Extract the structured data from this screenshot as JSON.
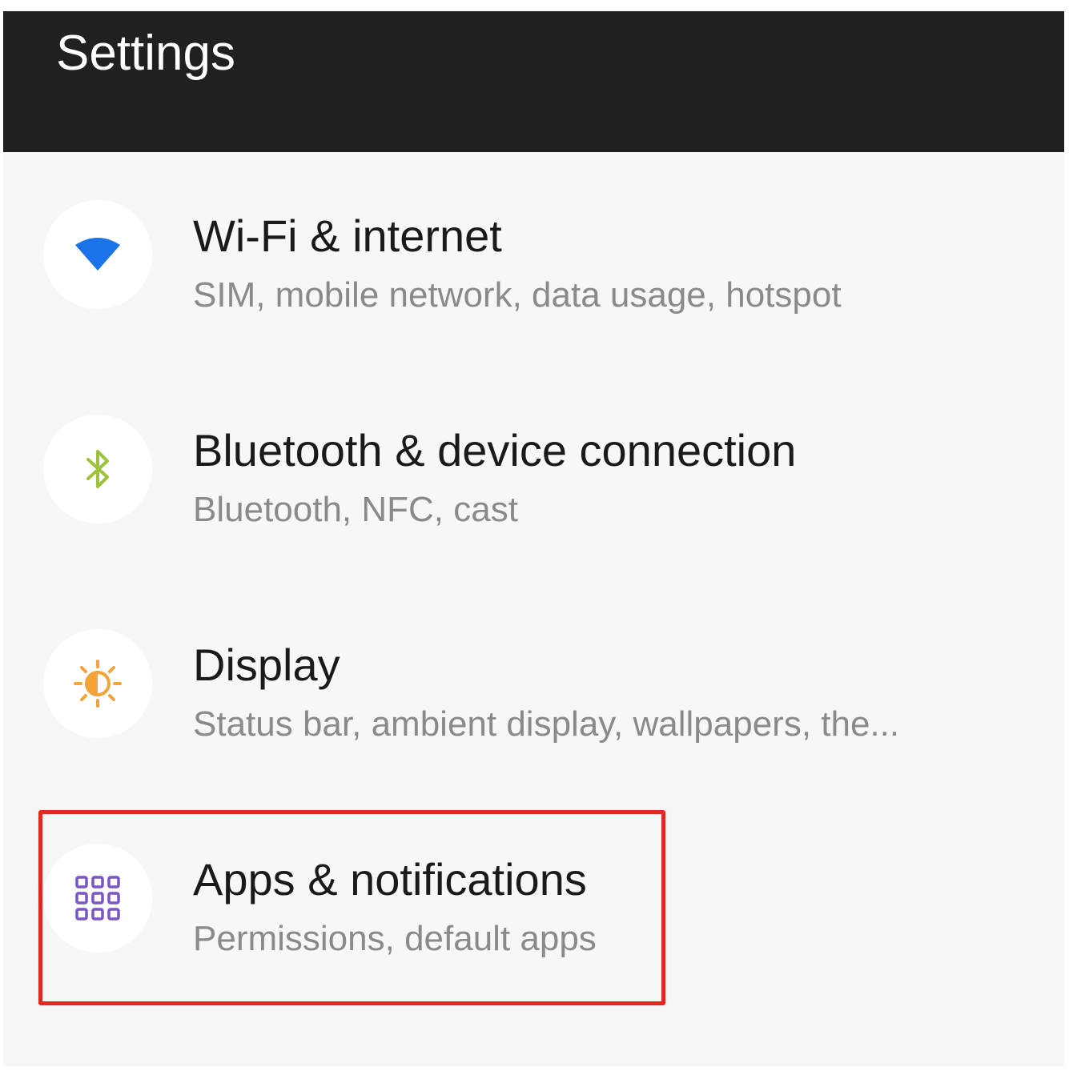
{
  "app_bar": {
    "title": "Settings"
  },
  "colors": {
    "wifi_icon": "#1a73e8",
    "bluetooth_icon": "#9cc33a",
    "display_icon": "#f2a33a",
    "apps_icon": "#7b57c4",
    "highlight": "#e0291c"
  },
  "settings_items": [
    {
      "title": "Wi-Fi & internet",
      "subtitle": "SIM, mobile network, data usage, hotspot",
      "icon": "wifi-icon"
    },
    {
      "title": "Bluetooth & device connection",
      "subtitle": "Bluetooth, NFC, cast",
      "icon": "bluetooth-icon"
    },
    {
      "title": "Display",
      "subtitle": "Status bar, ambient display, wallpapers, the...",
      "icon": "brightness-icon"
    },
    {
      "title": "Apps & notifications",
      "subtitle": "Permissions, default apps",
      "icon": "apps-grid-icon",
      "highlighted": true
    }
  ]
}
